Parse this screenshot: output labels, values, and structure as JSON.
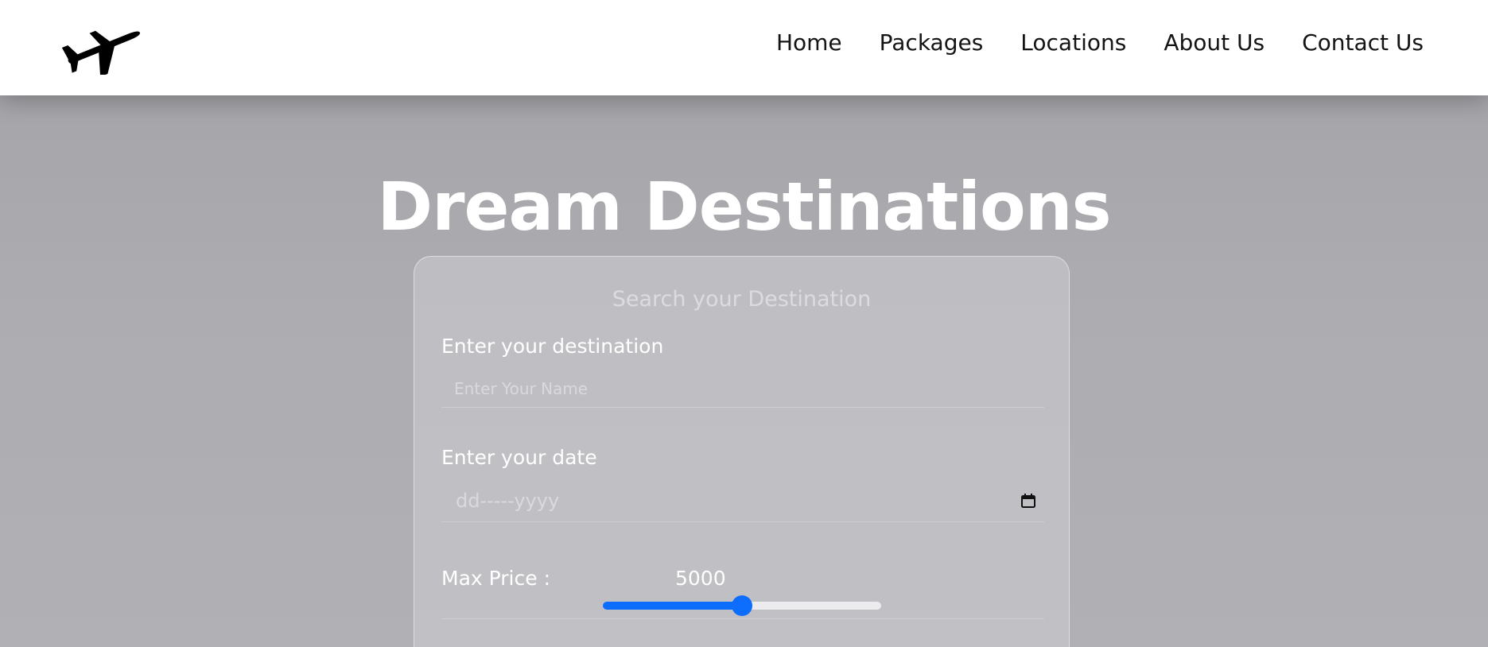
{
  "brand": {
    "logo_icon": "airplane-takeoff-icon"
  },
  "nav": {
    "items": [
      "Home",
      "Packages",
      "Locations",
      "About Us",
      "Contact Us"
    ]
  },
  "hero": {
    "title": "Dream Destinations"
  },
  "search_card": {
    "title": "Search your Destination",
    "destination": {
      "label": "Enter your destination",
      "placeholder": "Enter Your Name",
      "value": ""
    },
    "date": {
      "label": "Enter your date",
      "placeholder": "dd-----yyyy",
      "icon": "calendar-icon"
    },
    "price": {
      "label": "Max Price :",
      "value": "5000",
      "slider_fraction": 0.5
    }
  },
  "colors": {
    "accent": "#0d6efd",
    "hero_background": "#adadb1",
    "navbar_background": "#ffffff"
  }
}
